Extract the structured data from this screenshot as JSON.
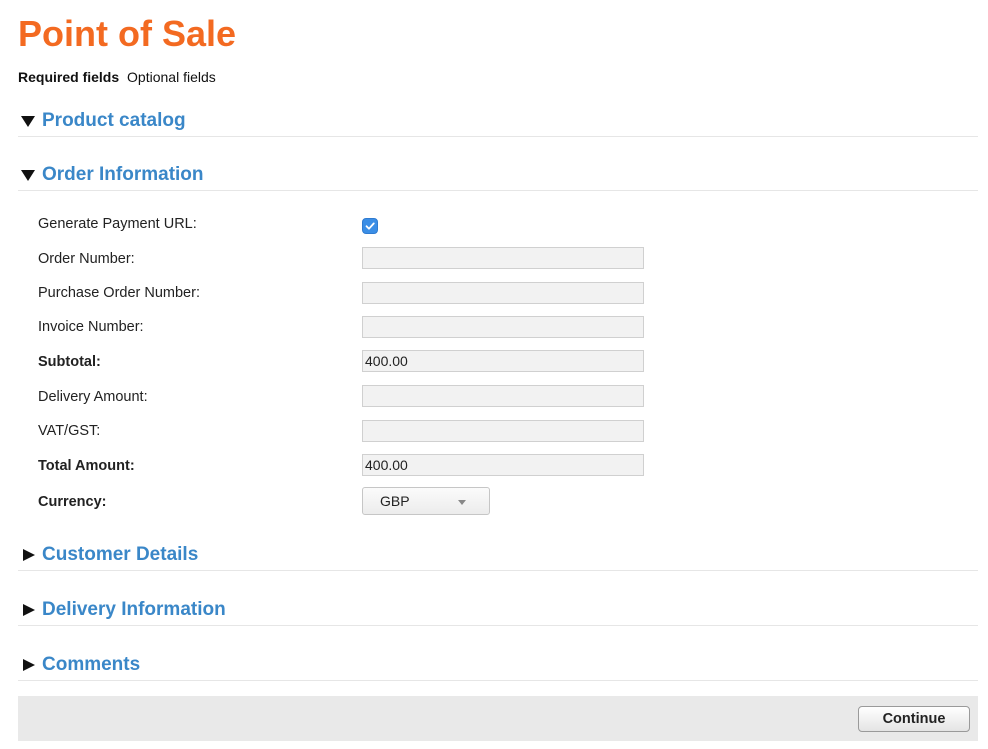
{
  "header": {
    "title": "Point of Sale",
    "required_label": "Required fields",
    "optional_label": "Optional fields"
  },
  "sections": {
    "product_catalog": {
      "label": "Product catalog",
      "expanded": true
    },
    "order_information": {
      "label": "Order Information",
      "expanded": true
    },
    "customer_details": {
      "label": "Customer Details",
      "expanded": false
    },
    "delivery_information": {
      "label": "Delivery Information",
      "expanded": false
    },
    "comments": {
      "label": "Comments",
      "expanded": false
    }
  },
  "order_form": {
    "generate_payment_url": {
      "label": "Generate Payment URL:",
      "checked": true
    },
    "order_number": {
      "label": "Order Number:",
      "value": ""
    },
    "purchase_order_number": {
      "label": "Purchase Order Number:",
      "value": ""
    },
    "invoice_number": {
      "label": "Invoice Number:",
      "value": ""
    },
    "subtotal": {
      "label": "Subtotal:",
      "value": "400.00"
    },
    "delivery_amount": {
      "label": "Delivery Amount:",
      "value": ""
    },
    "vat_gst": {
      "label": "VAT/GST:",
      "value": ""
    },
    "total_amount": {
      "label": "Total Amount:",
      "value": "400.00"
    },
    "currency": {
      "label": "Currency:",
      "value": "GBP"
    }
  },
  "footer": {
    "continue_label": "Continue"
  },
  "colors": {
    "title": "#f36a21",
    "section_heading": "#3a87c8",
    "checkbox": "#3b8ee6",
    "footer_bar": "#e9e9e9"
  },
  "icons": {
    "expanded": "triangle-down-icon",
    "collapsed": "triangle-right-icon",
    "checkbox": "checkmark-icon",
    "dropdown": "caret-down-icon"
  }
}
